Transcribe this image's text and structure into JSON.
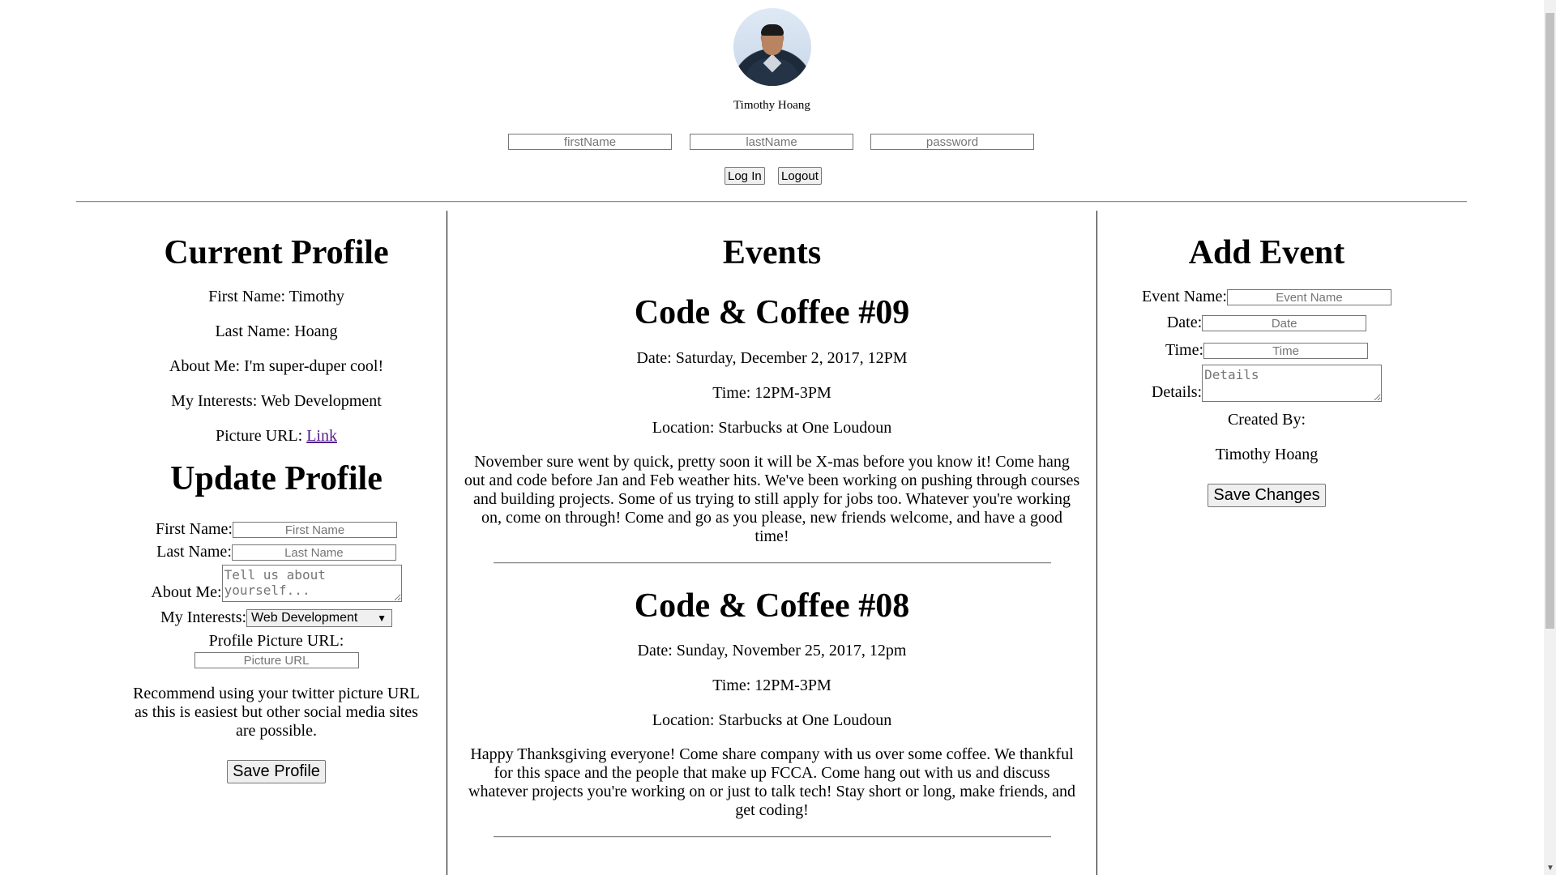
{
  "header": {
    "username": "Timothy Hoang",
    "first_name_placeholder": "firstName",
    "last_name_placeholder": "lastName",
    "password_placeholder": "password",
    "login_label": "Log In",
    "logout_label": "Logout"
  },
  "current_profile": {
    "title": "Current Profile",
    "first_name": "First Name: Timothy",
    "last_name": "Last Name: Hoang",
    "about_me": "About Me: I'm super-duper cool!",
    "interests": "My Interests: Web Development",
    "picture_label": "Picture URL: ",
    "picture_link": "Link"
  },
  "update_profile": {
    "title": "Update Profile",
    "first_name_label": "First Name:",
    "first_name_placeholder": "First Name",
    "last_name_label": "Last Name:",
    "last_name_placeholder": "Last Name",
    "about_label": "About Me:",
    "about_placeholder": "Tell us about yourself...",
    "interests_label": "My Interests:",
    "interests_selected": "Web Development",
    "picture_label": "Profile Picture URL:",
    "picture_placeholder": "Picture URL",
    "recommend_text": "Recommend using your twitter picture URL as this is easiest but other social media sites are possible.",
    "save_label": "Save Profile"
  },
  "events": {
    "title": "Events",
    "items": [
      {
        "name": "Code & Coffee #09",
        "date": "Date: Saturday, December 2, 2017, 12PM",
        "time": "Time: 12PM-3PM",
        "location": "Location: Starbucks at One Loudoun",
        "description": "November sure went by quick, pretty soon it will be X-mas before you know it! Come hang out and code before Jan and Feb weather hits. We've been working on pushing through courses and building projects. Some of us trying to still apply for jobs too. Whatever you're working on, come on through! Come and go as you please, new friends welcome, and have a good time!"
      },
      {
        "name": "Code & Coffee #08",
        "date": "Date: Sunday, November 25, 2017, 12pm",
        "time": "Time: 12PM-3PM",
        "location": "Location: Starbucks at One Loudoun",
        "description": "Happy Thanksgiving everyone! Come share company with us over some coffee. We thankful for this space and the people that make up FCCA. Come hang out with us and discuss whatever projects you're working on or just to talk tech! Stay short or long, make friends, and get coding!"
      }
    ]
  },
  "add_event": {
    "title": "Add Event",
    "name_label": "Event Name:",
    "name_placeholder": "Event Name",
    "date_label": "Date:",
    "date_placeholder": "Date",
    "time_label": "Time:",
    "time_placeholder": "Time",
    "details_label": "Details:",
    "details_placeholder": "Details",
    "created_by_label": "Created By:",
    "created_by": "Timothy Hoang",
    "save_label": "Save Changes"
  }
}
